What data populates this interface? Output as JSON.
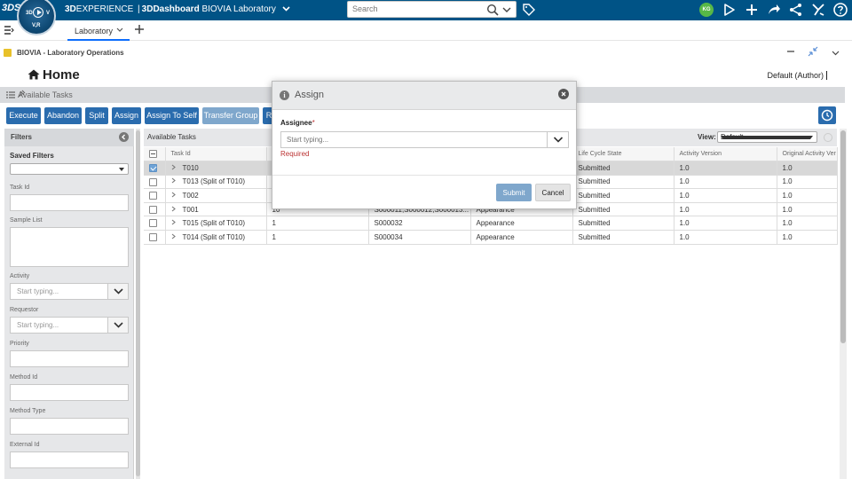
{
  "topbar": {
    "brand_mark": "3DS",
    "compass": {
      "left": "3D",
      "right": "V",
      "bottom": "V,R"
    },
    "app_prefix": "3D",
    "app_experience": "EXPERIENCE",
    "separator": "|",
    "app_dashboard": "3DDashboard",
    "app_name": "BIOVIA Laboratory",
    "search_placeholder": "Search",
    "user_initials": "KG",
    "bar_color": "#005386"
  },
  "tabs": [
    {
      "label": "Laboratory",
      "active": true
    }
  ],
  "widget": {
    "title": "BIOVIA - Laboratory Operations"
  },
  "page": {
    "title": "Home",
    "role": "Default (Author)"
  },
  "section": {
    "title": "Available Tasks"
  },
  "toolbar": {
    "buttons": [
      {
        "label": "Execute",
        "enabled": true
      },
      {
        "label": "Abandon",
        "enabled": true
      },
      {
        "label": "Split",
        "enabled": true
      },
      {
        "label": "Assign",
        "enabled": true
      },
      {
        "label": "Assign To Self",
        "enabled": true
      },
      {
        "label": "Transfer Group",
        "enabled": false
      },
      {
        "label": "R",
        "enabled": true
      }
    ],
    "accent_color": "#2a6cae"
  },
  "filters": {
    "title": "Filters",
    "saved_filters_label": "Saved Filters",
    "task_id_label": "Task Id",
    "sample_list_label": "Sample List",
    "activity_label": "Activity",
    "activity_placeholder": "Start typing...",
    "requestor_label": "Requestor",
    "requestor_placeholder": "Start typing...",
    "priority_label": "Priority",
    "method_id_label": "Method Id",
    "method_type_label": "Method Type",
    "external_id_label": "External Id"
  },
  "grid": {
    "title": "Available Tasks",
    "view_label": "View:",
    "view_value": "Default",
    "columns": [
      "Task Id",
      "",
      "",
      "",
      "Life Cycle State",
      "Activity Version",
      "Original Activity Ver"
    ],
    "rows": [
      {
        "task_id": "T010",
        "c2": "",
        "c3": "",
        "c4": "",
        "state": "Submitted",
        "activity_version": "1.0",
        "original_version": "1.0",
        "selected": true
      },
      {
        "task_id": "T013 (Split of T010)",
        "c2": "",
        "c3": "",
        "c4": "",
        "state": "Submitted",
        "activity_version": "1.0",
        "original_version": "1.0",
        "selected": false
      },
      {
        "task_id": "T002",
        "c2": "",
        "c3": "",
        "c4": "",
        "state": "Submitted",
        "activity_version": "1.0",
        "original_version": "1.0",
        "selected": false
      },
      {
        "task_id": "T001",
        "c2": "10",
        "c3": "S000011,S000012,S000013...",
        "c4": "Appearance",
        "state": "Submitted",
        "activity_version": "1.0",
        "original_version": "1.0",
        "selected": false
      },
      {
        "task_id": "T015 (Split of T010)",
        "c2": "1",
        "c3": "S000032",
        "c4": "Appearance",
        "state": "Submitted",
        "activity_version": "1.0",
        "original_version": "1.0",
        "selected": false
      },
      {
        "task_id": "T014 (Split of T010)",
        "c2": "1",
        "c3": "S000034",
        "c4": "Appearance",
        "state": "Submitted",
        "activity_version": "1.0",
        "original_version": "1.0",
        "selected": false
      }
    ]
  },
  "dialog": {
    "title": "Assign",
    "assignee_label": "Assignee",
    "required_mark": "*",
    "assignee_placeholder": "Start typing...",
    "error_text": "Required",
    "submit_label": "Submit",
    "cancel_label": "Cancel"
  }
}
